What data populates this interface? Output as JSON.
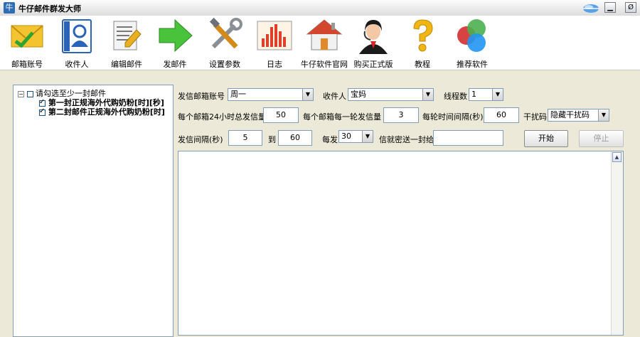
{
  "window": {
    "title": "牛仔邮件群发大师",
    "app_icon_glyph": "牛",
    "minimize_glyph": "▁",
    "close_glyph": "Ø"
  },
  "toolbar": [
    {
      "label": "邮箱账号",
      "icon": "envelope-icon"
    },
    {
      "label": "收件人",
      "icon": "contact-card-icon"
    },
    {
      "label": "编辑邮件",
      "icon": "edit-document-icon"
    },
    {
      "label": "发邮件",
      "icon": "green-arrow-icon"
    },
    {
      "label": "设置参数",
      "icon": "tools-icon"
    },
    {
      "label": "日志",
      "icon": "chart-icon"
    },
    {
      "label": "牛仔软件官网",
      "icon": "home-icon"
    },
    {
      "label": "购买正式版",
      "icon": "support-agent-icon"
    },
    {
      "label": "教程",
      "icon": "help-question-icon"
    },
    {
      "label": "推荐软件",
      "icon": "colored-circles-icon"
    }
  ],
  "tree": {
    "root_label": "请勾选至少一封邮件",
    "items": [
      {
        "label": "第一封正规海外代购奶粉[时][秒]",
        "checked": true
      },
      {
        "label": "第二封邮件正规海外代购奶粉[时]",
        "checked": true
      }
    ]
  },
  "form": {
    "sender_account_label": "发信邮箱账号",
    "sender_account_value": "周一",
    "recipient_label": "收件人",
    "recipient_value": "宝妈",
    "threads_label": "线程数",
    "threads_value": "1",
    "daily_total_label": "每个邮箱24小时总发信量",
    "daily_total_value": "50",
    "per_round_label": "每个邮箱每一轮发信量",
    "per_round_value": "3",
    "round_interval_label": "每轮时间间隔(秒)",
    "round_interval_value": "60",
    "interference_label": "干扰码",
    "interference_value": "隐藏干扰码",
    "interval_label": "发信间隔(秒)",
    "interval_from": "5",
    "to_label": "到",
    "interval_to": "60",
    "every_label": "每发",
    "every_value": "30",
    "bcc_label": "信就密送一封给",
    "bcc_value": "",
    "start_button": "开始",
    "stop_button": "停止"
  },
  "log": {
    "text": "",
    "scroll_up_glyph": "▲"
  }
}
